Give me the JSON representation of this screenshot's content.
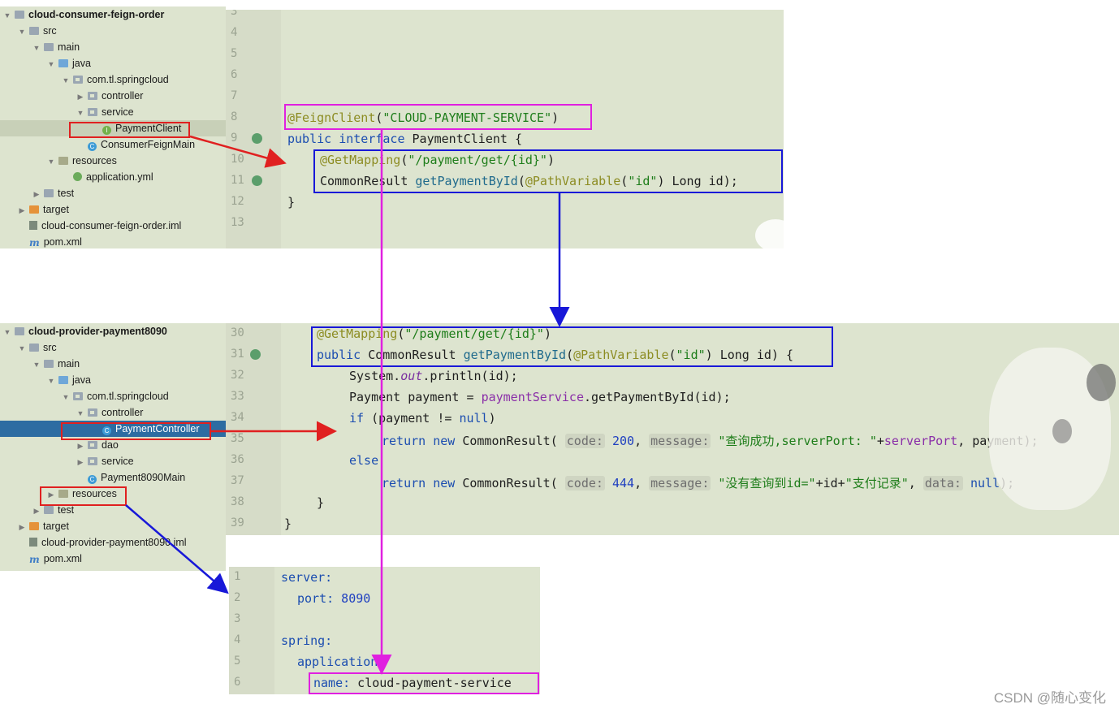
{
  "tree1": [
    {
      "label": "cloud-consumer-feign-order",
      "depth": 0,
      "toggle": "open",
      "icon": "module-folder-icon",
      "bold": true
    },
    {
      "label": "src",
      "depth": 1,
      "toggle": "open",
      "icon": "folder-icon"
    },
    {
      "label": "main",
      "depth": 2,
      "toggle": "open",
      "icon": "folder-icon"
    },
    {
      "label": "java",
      "depth": 3,
      "toggle": "open",
      "icon": "source-folder-icon"
    },
    {
      "label": "com.tl.springcloud",
      "depth": 4,
      "toggle": "open",
      "icon": "package-icon"
    },
    {
      "label": "controller",
      "depth": 5,
      "toggle": "closed",
      "icon": "package-icon"
    },
    {
      "label": "service",
      "depth": 5,
      "toggle": "open",
      "icon": "package-icon"
    },
    {
      "label": "PaymentClient",
      "depth": 6,
      "toggle": "none",
      "icon": "interface-icon",
      "highlight": true
    },
    {
      "label": "ConsumerFeignMain",
      "depth": 5,
      "toggle": "none",
      "icon": "class-icon"
    },
    {
      "label": "resources",
      "depth": 3,
      "toggle": "open",
      "icon": "resources-folder-icon"
    },
    {
      "label": "application.yml",
      "depth": 4,
      "toggle": "none",
      "icon": "yml-icon"
    },
    {
      "label": "test",
      "depth": 2,
      "toggle": "closed",
      "icon": "folder-icon"
    },
    {
      "label": "target",
      "depth": 1,
      "toggle": "closed",
      "icon": "target-folder-icon"
    },
    {
      "label": "cloud-consumer-feign-order.iml",
      "depth": 1,
      "toggle": "none",
      "icon": "iml-icon"
    },
    {
      "label": "pom.xml",
      "depth": 1,
      "toggle": "none",
      "icon": "maven-icon"
    }
  ],
  "tree2": [
    {
      "label": "cloud-provider-payment8090",
      "depth": 0,
      "toggle": "open",
      "icon": "module-folder-icon",
      "bold": true
    },
    {
      "label": "src",
      "depth": 1,
      "toggle": "open",
      "icon": "folder-icon"
    },
    {
      "label": "main",
      "depth": 2,
      "toggle": "open",
      "icon": "folder-icon"
    },
    {
      "label": "java",
      "depth": 3,
      "toggle": "open",
      "icon": "source-folder-icon"
    },
    {
      "label": "com.tl.springcloud",
      "depth": 4,
      "toggle": "open",
      "icon": "package-icon"
    },
    {
      "label": "controller",
      "depth": 5,
      "toggle": "open",
      "icon": "package-icon"
    },
    {
      "label": "PaymentController",
      "depth": 6,
      "toggle": "none",
      "icon": "class-icon",
      "selected": true
    },
    {
      "label": "dao",
      "depth": 5,
      "toggle": "closed",
      "icon": "package-icon"
    },
    {
      "label": "service",
      "depth": 5,
      "toggle": "closed",
      "icon": "package-icon"
    },
    {
      "label": "Payment8090Main",
      "depth": 5,
      "toggle": "none",
      "icon": "class-icon"
    },
    {
      "label": "resources",
      "depth": 3,
      "toggle": "closed",
      "icon": "resources-folder-icon"
    },
    {
      "label": "test",
      "depth": 2,
      "toggle": "closed",
      "icon": "folder-icon"
    },
    {
      "label": "target",
      "depth": 1,
      "toggle": "closed",
      "icon": "target-folder-icon"
    },
    {
      "label": "cloud-provider-payment8090.iml",
      "depth": 1,
      "toggle": "none",
      "icon": "iml-icon"
    },
    {
      "label": "pom.xml",
      "depth": 1,
      "toggle": "none",
      "icon": "maven-icon"
    }
  ],
  "editor1": {
    "line_numbers": [
      "3",
      "4",
      "5",
      "6",
      "7",
      "8",
      "9",
      "10",
      "11",
      "12",
      "13"
    ],
    "code": {
      "l8": {
        "annotation": "@FeignClient",
        "open": "(",
        "string": "\"CLOUD-PAYMENT-SERVICE\"",
        "close": ")"
      },
      "l9": {
        "kw1": "public",
        "kw2": "interface",
        "rest": " PaymentClient {"
      },
      "l10": {
        "annotation": "@GetMapping",
        "open": "(",
        "string": "\"/payment/get/{id}\"",
        "close": ")"
      },
      "l11": {
        "type": "CommonResult",
        "method": "getPaymentById",
        "open": "(",
        "annotation": "@PathVariable",
        "open2": "(",
        "string": "\"id\"",
        "rest": ") Long id);"
      },
      "l12": {
        "text": "}"
      }
    }
  },
  "editor2": {
    "line_numbers": [
      "30",
      "31",
      "32",
      "33",
      "34",
      "35",
      "36",
      "37",
      "38",
      "39"
    ],
    "code": {
      "l30": {
        "annotation": "@GetMapping",
        "open": "(",
        "string": "\"/payment/get/{id}\"",
        "close": ")"
      },
      "l31": {
        "kw": "public",
        "type": " CommonResult ",
        "method": "getPaymentById",
        "open": "(",
        "annotation": "@PathVariable",
        "open2": "(",
        "string": "\"id\"",
        "rest": ") Long id) {"
      },
      "l32": {
        "pre": "System.",
        "field": "out",
        "post": ".println(id);"
      },
      "l33": {
        "pre": "Payment payment = ",
        "field": "paymentService",
        "post": ".getPaymentById(id);"
      },
      "l34": {
        "kw": "if",
        "rest": " (payment != ",
        "kw2": "null",
        "close": ")"
      },
      "l35": {
        "kw": "return",
        "kw2": "new",
        "type": "CommonResult(",
        "h1": "code:",
        "n1": "200",
        "sep": ", ",
        "h2": "message:",
        "s1": "\"查询成功,serverPort: \"",
        "plus": "+",
        "field": "serverPort",
        "rest": ", payment);"
      },
      "l36": {
        "kw": "else"
      },
      "l37": {
        "kw": "return",
        "kw2": "new",
        "type": "CommonResult(",
        "h1": "code:",
        "n1": "444",
        "sep": ", ",
        "h2": "message:",
        "s1": "\"没有查询到id=\"",
        "mid": "+id+",
        "s2": "\"支付记录\"",
        "sep2": ", ",
        "h3": "data:",
        "n2": "null",
        "rest": ");"
      },
      "l38": {
        "text": "}"
      },
      "l39": {
        "text": "}"
      }
    }
  },
  "editor3": {
    "line_numbers": [
      "1",
      "2",
      "3",
      "4",
      "5",
      "6"
    ],
    "yaml": {
      "l1": {
        "key": "server:"
      },
      "l2": {
        "key": "port:",
        "value": " 8090"
      },
      "l4": {
        "key": "spring:"
      },
      "l5": {
        "key": "application:"
      },
      "l6": {
        "key": "name:",
        "value": " cloud-payment-service"
      }
    }
  },
  "watermark": "CSDN @随心变化",
  "colors": {
    "red": "#e02020",
    "blue": "#1818d8",
    "magenta": "#e020e0",
    "selection": "#2d6ca2",
    "panel": "#dde4cf"
  }
}
